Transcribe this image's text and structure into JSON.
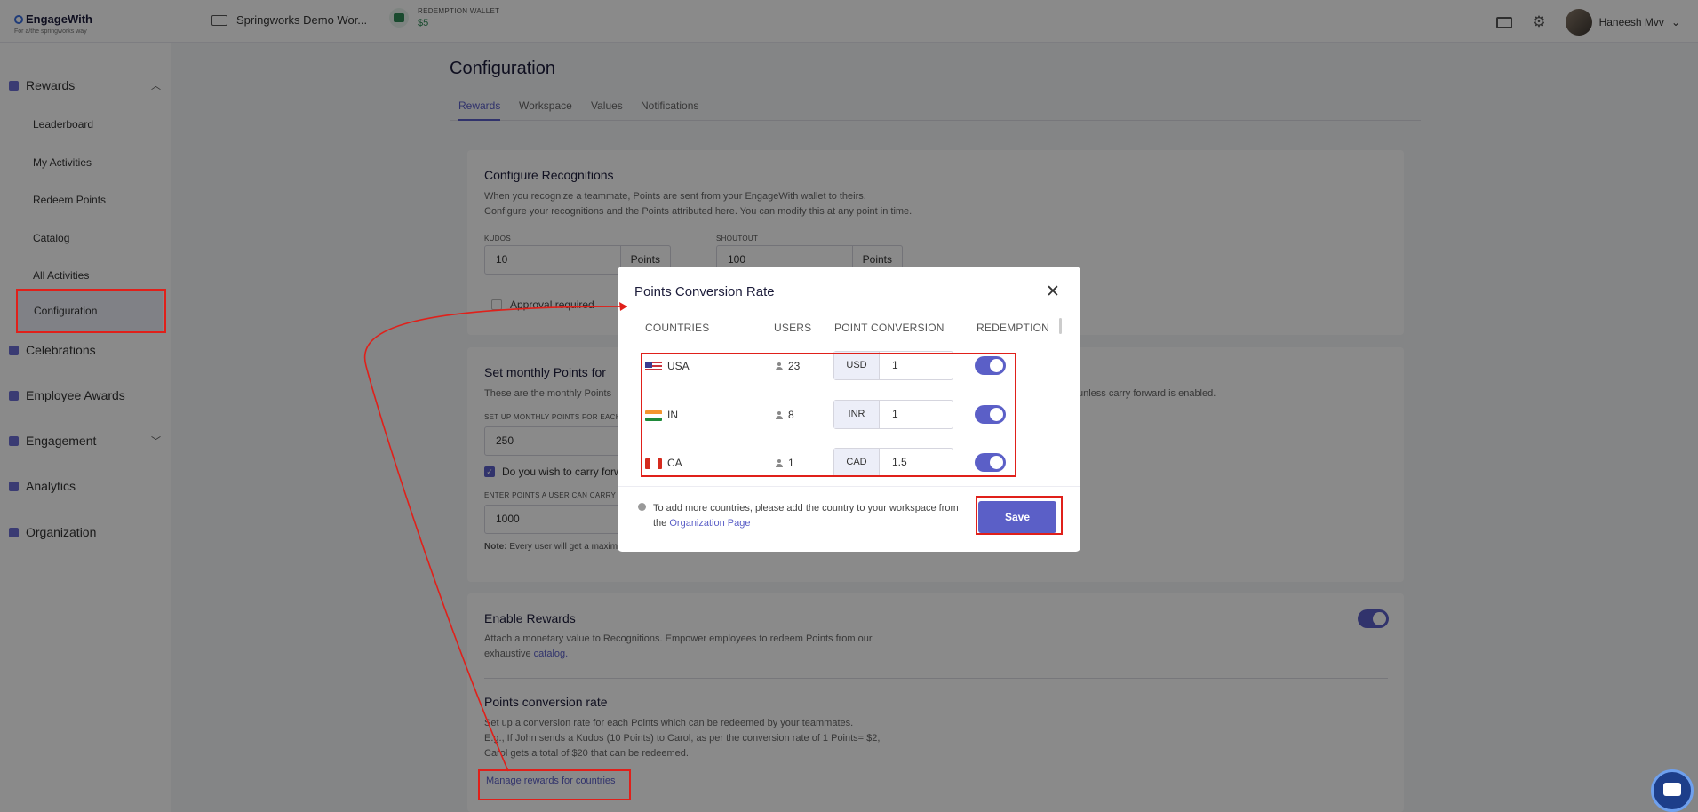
{
  "app": {
    "logo": "EngageWith",
    "logo_tagline": "For a/the springworks way"
  },
  "topbar": {
    "workspace": "Springworks Demo Wor...",
    "wallet_label": "REDEMPTION WALLET",
    "wallet_value": "$5",
    "user_name": "Haneesh Mvv",
    "icons": [
      "card-icon",
      "gear-icon",
      "chevron-down-icon"
    ]
  },
  "sidebar": {
    "rewards": "Rewards",
    "sub_items": [
      "Leaderboard",
      "My Activities",
      "Redeem Points",
      "Catalog",
      "All Activities",
      "Configuration"
    ],
    "celebrations": "Celebrations",
    "employee_awards": "Employee Awards",
    "engagement": "Engagement",
    "analytics": "Analytics",
    "organization": "Organization"
  },
  "page": {
    "title": "Configuration",
    "tabs": [
      "Rewards",
      "Workspace",
      "Values",
      "Notifications"
    ],
    "active_tab": "Rewards"
  },
  "recognitions": {
    "title": "Configure Recognitions",
    "desc1": "When you recognize a teammate, Points are sent from your EngageWith wallet to theirs.",
    "desc2": "Configure your recognitions and the Points attributed here. You can modify this at any point in time.",
    "kudos_label": "KUDOS",
    "kudos_value": "10",
    "shoutout_label": "SHOUTOUT",
    "shoutout_value": "100",
    "points_addon": "Points",
    "approval": "Approval required"
  },
  "monthly": {
    "title": "Set monthly Points for",
    "desc": "These are the monthly Points",
    "desc_right": "unless carry forward is enabled.",
    "setup_label": "SET UP MONTHLY POINTS FOR EACH",
    "setup_value": "250",
    "carry_label": "Do you wish to carry forw",
    "carry_checked": true,
    "enter_label": "ENTER POINTS A USER CAN CARRY F",
    "enter_value": "1000",
    "note_bold": "Note:",
    "note": "Every user will get a maxim"
  },
  "rewards_panel": {
    "enable_title": "Enable Rewards",
    "enable_desc1": "Attach a monetary value to Recognitions. Empower employees to redeem Points from our",
    "enable_desc2_prefix": "exhaustive",
    "enable_desc2_link": "catalog.",
    "enabled": true,
    "conv_title": "Points conversion rate",
    "conv_desc1": "Set up a conversion rate for each Points which can be redeemed by your teammates.",
    "conv_desc2": "E.g., If John sends a Kudos (10 Points) to Carol, as per the conversion rate of 1 Points= $2,",
    "conv_desc3": "Carol gets a total of $20 that can be redeemed.",
    "manage_link": "Manage rewards for countries"
  },
  "modal": {
    "title": "Points Conversion Rate",
    "columns": [
      "COUNTRIES",
      "USERS",
      "POINT CONVERSION",
      "REDEMPTION"
    ],
    "rows": [
      {
        "country": "USA",
        "users": "23",
        "currency": "USD",
        "rate": "1",
        "redemption": true
      },
      {
        "country": "IN",
        "users": "8",
        "currency": "INR",
        "rate": "1",
        "redemption": true
      },
      {
        "country": "CA",
        "users": "1",
        "currency": "CAD",
        "rate": "1.5",
        "redemption": true
      }
    ],
    "footer_text": "To add more countries, please add the country to your workspace from the",
    "footer_link": "Organization Page",
    "save": "Save"
  },
  "colors": {
    "accent": "#5b5fc7",
    "annotation": "#e0201a",
    "wallet": "#2f8a56"
  }
}
